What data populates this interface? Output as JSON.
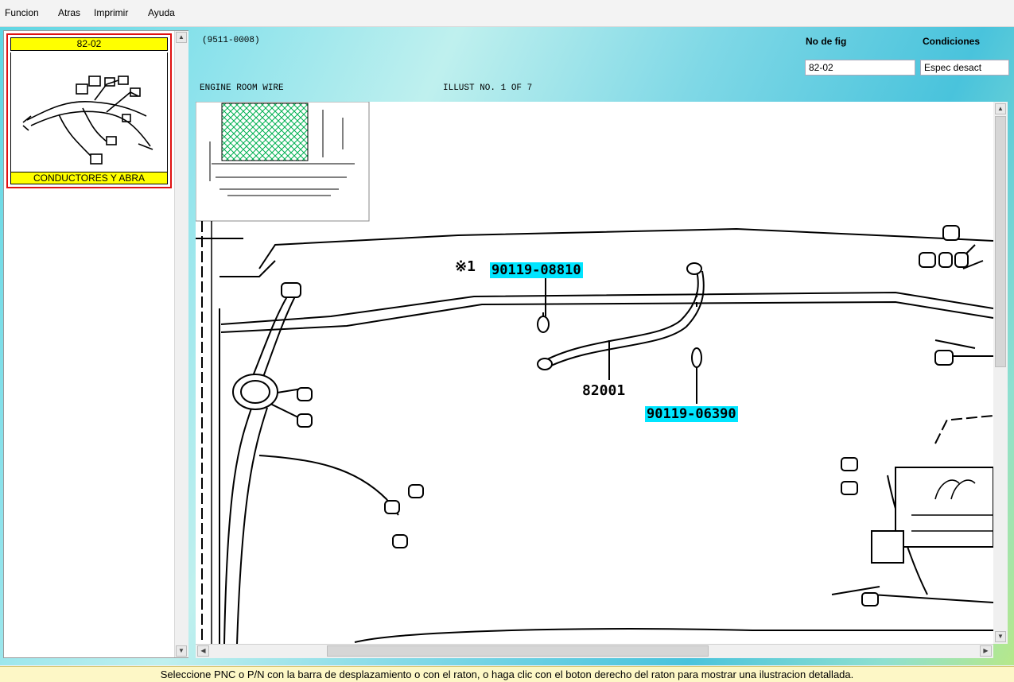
{
  "menu": {
    "items": [
      "Funcion",
      "Atras",
      "Imprimir",
      "Ayuda"
    ]
  },
  "left_panel": {
    "thumbnail": {
      "fig_no": "82-02",
      "caption": "CONDUCTORES Y ABRA"
    }
  },
  "header": {
    "code": "(9511-0008)",
    "title": "ENGINE ROOM WIRE",
    "illust": "ILLUST NO. 1 OF 7",
    "fig_label": "No de fig",
    "fig_value": "82-02",
    "cond_label": "Condiciones",
    "cond_value": "Espec desact"
  },
  "drawing": {
    "callouts": [
      {
        "text": "※1",
        "type": "note"
      },
      {
        "text": "90119-08810",
        "type": "part"
      },
      {
        "text": "82001",
        "type": "pnc"
      },
      {
        "text": "90119-06390",
        "type": "part"
      }
    ]
  },
  "status": {
    "message": "Seleccione PNC o P/N con la barra de desplazamiento o con el raton, o haga clic con el boton derecho del raton para mostrar una ilustracion detallada."
  },
  "colors": {
    "highlight": "#00e5ff",
    "thumb_header": "#ffff00",
    "selection_border": "#e01010",
    "overview_hatch": "#00b050",
    "status_bg": "#fdf7c6"
  }
}
